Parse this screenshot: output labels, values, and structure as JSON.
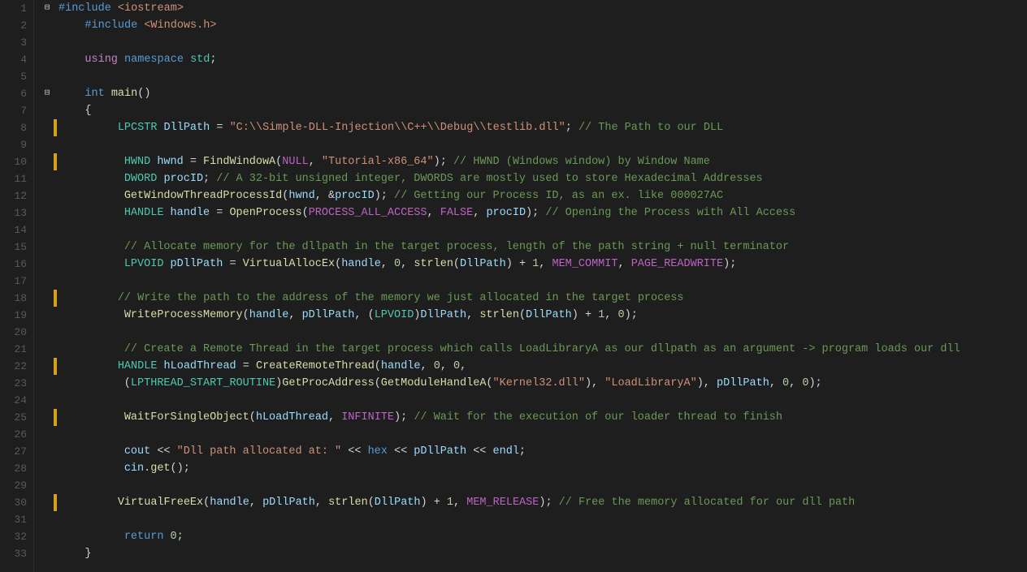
{
  "lines": [
    {
      "num": 1,
      "fold": "minus",
      "indent": 0,
      "tokens": [
        {
          "t": "kw",
          "v": "#include"
        },
        {
          "t": "plain",
          "v": " "
        },
        {
          "t": "str",
          "v": "<iostream>"
        }
      ]
    },
    {
      "num": 2,
      "fold": "",
      "indent": 0,
      "tokens": [
        {
          "t": "plain",
          "v": "    "
        },
        {
          "t": "kw",
          "v": "#include"
        },
        {
          "t": "plain",
          "v": " "
        },
        {
          "t": "str",
          "v": "<Windows.h>"
        }
      ]
    },
    {
      "num": 3,
      "fold": "",
      "indent": 0,
      "tokens": []
    },
    {
      "num": 4,
      "fold": "",
      "indent": 0,
      "tokens": [
        {
          "t": "plain",
          "v": "    "
        },
        {
          "t": "kw2",
          "v": "using"
        },
        {
          "t": "plain",
          "v": " "
        },
        {
          "t": "kw",
          "v": "namespace"
        },
        {
          "t": "plain",
          "v": " "
        },
        {
          "t": "std-ns",
          "v": "std"
        },
        {
          "t": "plain",
          "v": ";"
        }
      ]
    },
    {
      "num": 5,
      "fold": "",
      "indent": 0,
      "tokens": []
    },
    {
      "num": 6,
      "fold": "minus",
      "indent": 0,
      "tokens": [
        {
          "t": "plain",
          "v": "    "
        },
        {
          "t": "kw",
          "v": "int"
        },
        {
          "t": "plain",
          "v": " "
        },
        {
          "t": "fn",
          "v": "main"
        },
        {
          "t": "plain",
          "v": "()"
        }
      ]
    },
    {
      "num": 7,
      "fold": "",
      "indent": 0,
      "tokens": [
        {
          "t": "plain",
          "v": "    {"
        }
      ]
    },
    {
      "num": 8,
      "fold": "",
      "indent": 1,
      "tokens": [
        {
          "t": "plain",
          "v": "        "
        },
        {
          "t": "type",
          "v": "LPCSTR"
        },
        {
          "t": "plain",
          "v": " "
        },
        {
          "t": "var",
          "v": "DllPath"
        },
        {
          "t": "plain",
          "v": " = "
        },
        {
          "t": "str",
          "v": "\"C:\\\\Simple-DLL-Injection\\\\C++\\\\Debug\\\\testlib.dll\""
        },
        {
          "t": "plain",
          "v": "; "
        },
        {
          "t": "cmt",
          "v": "// The Path to our DLL"
        }
      ]
    },
    {
      "num": 9,
      "fold": "",
      "indent": 1,
      "tokens": []
    },
    {
      "num": 10,
      "fold": "",
      "indent": 2,
      "tokens": [
        {
          "t": "plain",
          "v": "        "
        },
        {
          "t": "type",
          "v": "HWND"
        },
        {
          "t": "plain",
          "v": " "
        },
        {
          "t": "var",
          "v": "hwnd"
        },
        {
          "t": "plain",
          "v": " = "
        },
        {
          "t": "fn",
          "v": "FindWindowA"
        },
        {
          "t": "plain",
          "v": "("
        },
        {
          "t": "mac",
          "v": "NULL"
        },
        {
          "t": "plain",
          "v": ", "
        },
        {
          "t": "str",
          "v": "\"Tutorial-x86_64\""
        },
        {
          "t": "plain",
          "v": "); "
        },
        {
          "t": "cmt",
          "v": "// HWND (Windows window) by Window Name"
        }
      ]
    },
    {
      "num": 11,
      "fold": "",
      "indent": 2,
      "tokens": [
        {
          "t": "plain",
          "v": "        "
        },
        {
          "t": "type",
          "v": "DWORD"
        },
        {
          "t": "plain",
          "v": " "
        },
        {
          "t": "var",
          "v": "procID"
        },
        {
          "t": "plain",
          "v": "; "
        },
        {
          "t": "cmt",
          "v": "// A 32-bit unsigned integer, DWORDS are mostly used to store Hexadecimal Addresses"
        }
      ]
    },
    {
      "num": 12,
      "fold": "",
      "indent": 2,
      "tokens": [
        {
          "t": "plain",
          "v": "        "
        },
        {
          "t": "fn",
          "v": "GetWindowThreadProcessId"
        },
        {
          "t": "plain",
          "v": "("
        },
        {
          "t": "var",
          "v": "hwnd"
        },
        {
          "t": "plain",
          "v": ", &"
        },
        {
          "t": "var",
          "v": "procID"
        },
        {
          "t": "plain",
          "v": "); "
        },
        {
          "t": "cmt",
          "v": "// Getting our Process ID, as an ex. like 000027AC"
        }
      ]
    },
    {
      "num": 13,
      "fold": "",
      "indent": 2,
      "tokens": [
        {
          "t": "plain",
          "v": "        "
        },
        {
          "t": "type",
          "v": "HANDLE"
        },
        {
          "t": "plain",
          "v": " "
        },
        {
          "t": "var",
          "v": "handle"
        },
        {
          "t": "plain",
          "v": " = "
        },
        {
          "t": "fn",
          "v": "OpenProcess"
        },
        {
          "t": "plain",
          "v": "("
        },
        {
          "t": "mac",
          "v": "PROCESS_ALL_ACCESS"
        },
        {
          "t": "plain",
          "v": ", "
        },
        {
          "t": "mac",
          "v": "FALSE"
        },
        {
          "t": "plain",
          "v": ", "
        },
        {
          "t": "var",
          "v": "procID"
        },
        {
          "t": "plain",
          "v": "); "
        },
        {
          "t": "cmt",
          "v": "// Opening the Process with All Access"
        }
      ]
    },
    {
      "num": 14,
      "fold": "",
      "indent": 2,
      "tokens": []
    },
    {
      "num": 15,
      "fold": "",
      "indent": 2,
      "tokens": [
        {
          "t": "plain",
          "v": "        "
        },
        {
          "t": "cmt",
          "v": "// Allocate memory for the dllpath in the target process, length of the path string + null terminator"
        }
      ]
    },
    {
      "num": 16,
      "fold": "",
      "indent": 2,
      "tokens": [
        {
          "t": "plain",
          "v": "        "
        },
        {
          "t": "type",
          "v": "LPVOID"
        },
        {
          "t": "plain",
          "v": " "
        },
        {
          "t": "var",
          "v": "pDllPath"
        },
        {
          "t": "plain",
          "v": " = "
        },
        {
          "t": "fn",
          "v": "VirtualAllocEx"
        },
        {
          "t": "plain",
          "v": "("
        },
        {
          "t": "var",
          "v": "handle"
        },
        {
          "t": "plain",
          "v": ", "
        },
        {
          "t": "num",
          "v": "0"
        },
        {
          "t": "plain",
          "v": ", "
        },
        {
          "t": "fn",
          "v": "strlen"
        },
        {
          "t": "plain",
          "v": "("
        },
        {
          "t": "var",
          "v": "DllPath"
        },
        {
          "t": "plain",
          "v": ") + "
        },
        {
          "t": "num",
          "v": "1"
        },
        {
          "t": "plain",
          "v": ", "
        },
        {
          "t": "mac",
          "v": "MEM_COMMIT"
        },
        {
          "t": "plain",
          "v": ", "
        },
        {
          "t": "mac",
          "v": "PAGE_READWRITE"
        },
        {
          "t": "plain",
          "v": ");"
        }
      ]
    },
    {
      "num": 17,
      "fold": "",
      "indent": 2,
      "tokens": []
    },
    {
      "num": 18,
      "fold": "",
      "indent": 1,
      "tokens": [
        {
          "t": "plain",
          "v": "        "
        },
        {
          "t": "cmt",
          "v": "// Write the path to the address of the memory we just allocated in the target process"
        }
      ]
    },
    {
      "num": 19,
      "fold": "",
      "indent": 2,
      "tokens": [
        {
          "t": "plain",
          "v": "        "
        },
        {
          "t": "fn",
          "v": "WriteProcessMemory"
        },
        {
          "t": "plain",
          "v": "("
        },
        {
          "t": "var",
          "v": "handle"
        },
        {
          "t": "plain",
          "v": ", "
        },
        {
          "t": "var",
          "v": "pDllPath"
        },
        {
          "t": "plain",
          "v": ", ("
        },
        {
          "t": "type",
          "v": "LPVOID"
        },
        {
          "t": "plain",
          "v": ")"
        },
        {
          "t": "var",
          "v": "DllPath"
        },
        {
          "t": "plain",
          "v": ", "
        },
        {
          "t": "fn",
          "v": "strlen"
        },
        {
          "t": "plain",
          "v": "("
        },
        {
          "t": "var",
          "v": "DllPath"
        },
        {
          "t": "plain",
          "v": ") + "
        },
        {
          "t": "num",
          "v": "1"
        },
        {
          "t": "plain",
          "v": ", "
        },
        {
          "t": "num",
          "v": "0"
        },
        {
          "t": "plain",
          "v": ");"
        }
      ]
    },
    {
      "num": 20,
      "fold": "",
      "indent": 2,
      "tokens": []
    },
    {
      "num": 21,
      "fold": "",
      "indent": 2,
      "tokens": [
        {
          "t": "plain",
          "v": "        "
        },
        {
          "t": "cmt",
          "v": "// Create a Remote Thread in the target process which calls LoadLibraryA as our dllpath as an argument -> program loads our dll"
        }
      ]
    },
    {
      "num": 22,
      "fold": "",
      "indent": 1,
      "tokens": [
        {
          "t": "plain",
          "v": "        "
        },
        {
          "t": "type",
          "v": "HANDLE"
        },
        {
          "t": "plain",
          "v": " "
        },
        {
          "t": "var",
          "v": "hLoadThread"
        },
        {
          "t": "plain",
          "v": " = "
        },
        {
          "t": "fn",
          "v": "CreateRemoteThread"
        },
        {
          "t": "plain",
          "v": "("
        },
        {
          "t": "var",
          "v": "handle"
        },
        {
          "t": "plain",
          "v": ", "
        },
        {
          "t": "num",
          "v": "0"
        },
        {
          "t": "plain",
          "v": ", "
        },
        {
          "t": "num",
          "v": "0"
        },
        {
          "t": "plain",
          "v": ","
        }
      ]
    },
    {
      "num": 23,
      "fold": "",
      "indent": 2,
      "tokens": [
        {
          "t": "plain",
          "v": "        ("
        },
        {
          "t": "type",
          "v": "LPTHREAD_START_ROUTINE"
        },
        {
          "t": "plain",
          "v": ")"
        },
        {
          "t": "fn",
          "v": "GetProcAddress"
        },
        {
          "t": "plain",
          "v": "("
        },
        {
          "t": "fn",
          "v": "GetModuleHandleA"
        },
        {
          "t": "plain",
          "v": "("
        },
        {
          "t": "str",
          "v": "\"Kernel32.dll\""
        },
        {
          "t": "plain",
          "v": "), "
        },
        {
          "t": "str",
          "v": "\"LoadLibraryA\""
        },
        {
          "t": "plain",
          "v": "), "
        },
        {
          "t": "var",
          "v": "pDllPath"
        },
        {
          "t": "plain",
          "v": ", "
        },
        {
          "t": "num",
          "v": "0"
        },
        {
          "t": "plain",
          "v": ", "
        },
        {
          "t": "num",
          "v": "0"
        },
        {
          "t": "plain",
          "v": ");"
        }
      ]
    },
    {
      "num": 24,
      "fold": "",
      "indent": 2,
      "tokens": []
    },
    {
      "num": 25,
      "fold": "",
      "indent": 2,
      "tokens": [
        {
          "t": "plain",
          "v": "        "
        },
        {
          "t": "fn",
          "v": "WaitForSingleObject"
        },
        {
          "t": "plain",
          "v": "("
        },
        {
          "t": "var",
          "v": "hLoadThread"
        },
        {
          "t": "plain",
          "v": ", "
        },
        {
          "t": "mac",
          "v": "INFINITE"
        },
        {
          "t": "plain",
          "v": "); "
        },
        {
          "t": "cmt",
          "v": "// Wait for the execution of our loader thread to finish"
        }
      ]
    },
    {
      "num": 26,
      "fold": "",
      "indent": 2,
      "tokens": []
    },
    {
      "num": 27,
      "fold": "",
      "indent": 2,
      "tokens": [
        {
          "t": "plain",
          "v": "        "
        },
        {
          "t": "var",
          "v": "cout"
        },
        {
          "t": "plain",
          "v": " << "
        },
        {
          "t": "str",
          "v": "\"Dll path allocated at: \""
        },
        {
          "t": "plain",
          "v": " << "
        },
        {
          "t": "kw",
          "v": "hex"
        },
        {
          "t": "plain",
          "v": " << "
        },
        {
          "t": "var",
          "v": "pDllPath"
        },
        {
          "t": "plain",
          "v": " << "
        },
        {
          "t": "var",
          "v": "endl"
        },
        {
          "t": "plain",
          "v": ";"
        }
      ]
    },
    {
      "num": 28,
      "fold": "",
      "indent": 2,
      "tokens": [
        {
          "t": "plain",
          "v": "        "
        },
        {
          "t": "var",
          "v": "cin"
        },
        {
          "t": "plain",
          "v": "."
        },
        {
          "t": "fn",
          "v": "get"
        },
        {
          "t": "plain",
          "v": "();"
        }
      ]
    },
    {
      "num": 29,
      "fold": "",
      "indent": 2,
      "tokens": []
    },
    {
      "num": 30,
      "fold": "",
      "indent": 1,
      "tokens": [
        {
          "t": "plain",
          "v": "        "
        },
        {
          "t": "fn",
          "v": "VirtualFreeEx"
        },
        {
          "t": "plain",
          "v": "("
        },
        {
          "t": "var",
          "v": "handle"
        },
        {
          "t": "plain",
          "v": ", "
        },
        {
          "t": "var",
          "v": "pDllPath"
        },
        {
          "t": "plain",
          "v": ", "
        },
        {
          "t": "fn",
          "v": "strlen"
        },
        {
          "t": "plain",
          "v": "("
        },
        {
          "t": "var",
          "v": "DllPath"
        },
        {
          "t": "plain",
          "v": ") + "
        },
        {
          "t": "num",
          "v": "1"
        },
        {
          "t": "plain",
          "v": ", "
        },
        {
          "t": "mac",
          "v": "MEM_RELEASE"
        },
        {
          "t": "plain",
          "v": "); "
        },
        {
          "t": "cmt",
          "v": "// Free the memory allocated for our dll path"
        }
      ]
    },
    {
      "num": 31,
      "fold": "",
      "indent": 2,
      "tokens": []
    },
    {
      "num": 32,
      "fold": "",
      "indent": 2,
      "tokens": [
        {
          "t": "plain",
          "v": "        "
        },
        {
          "t": "kw",
          "v": "return"
        },
        {
          "t": "plain",
          "v": " "
        },
        {
          "t": "num",
          "v": "0"
        },
        {
          "t": "plain",
          "v": ";"
        }
      ]
    },
    {
      "num": 33,
      "fold": "",
      "indent": 0,
      "tokens": [
        {
          "t": "plain",
          "v": "    }"
        }
      ]
    }
  ]
}
